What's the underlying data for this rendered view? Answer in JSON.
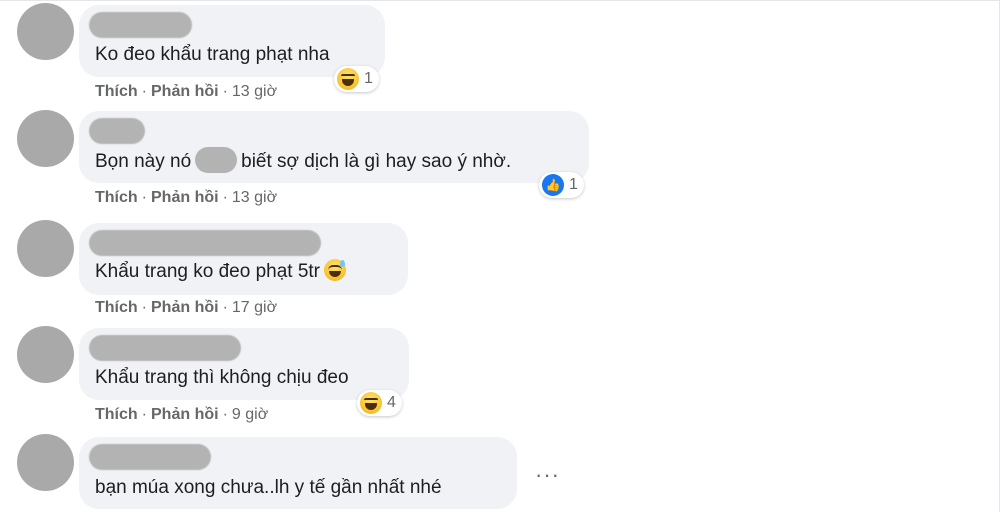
{
  "meta_labels": {
    "like": "Thích",
    "reply": "Phản hồi",
    "separator": "·"
  },
  "comments": [
    {
      "text": "Ko đeo khẩu trang phạt nha",
      "time": "13 giờ",
      "reaction": {
        "type": "haha",
        "count": "1"
      }
    },
    {
      "text_before": "Bọn này nó",
      "text_after": "biết sợ dịch là gì hay sao ý nhờ.",
      "time": "13 giờ",
      "reaction": {
        "type": "like",
        "count": "1"
      }
    },
    {
      "text": "Khẩu trang ko đeo phạt 5tr",
      "time": "17 giờ",
      "inline_emoji": "grinning-sweat"
    },
    {
      "text": "Khẩu trang thì không chịu đeo",
      "time": "9 giờ",
      "reaction": {
        "type": "haha",
        "count": "4"
      }
    },
    {
      "text": "bạn múa xong chưa..lh y tế gần nhất nhé"
    }
  ],
  "more_options": "···",
  "icons": {
    "like": "thumbs-up-icon",
    "haha": "laughing-emoji-icon",
    "more": "more-options-icon"
  },
  "colors": {
    "bubble": "#f0f2f5",
    "meta_text": "#65676b",
    "like_blue": "#1877f2"
  }
}
